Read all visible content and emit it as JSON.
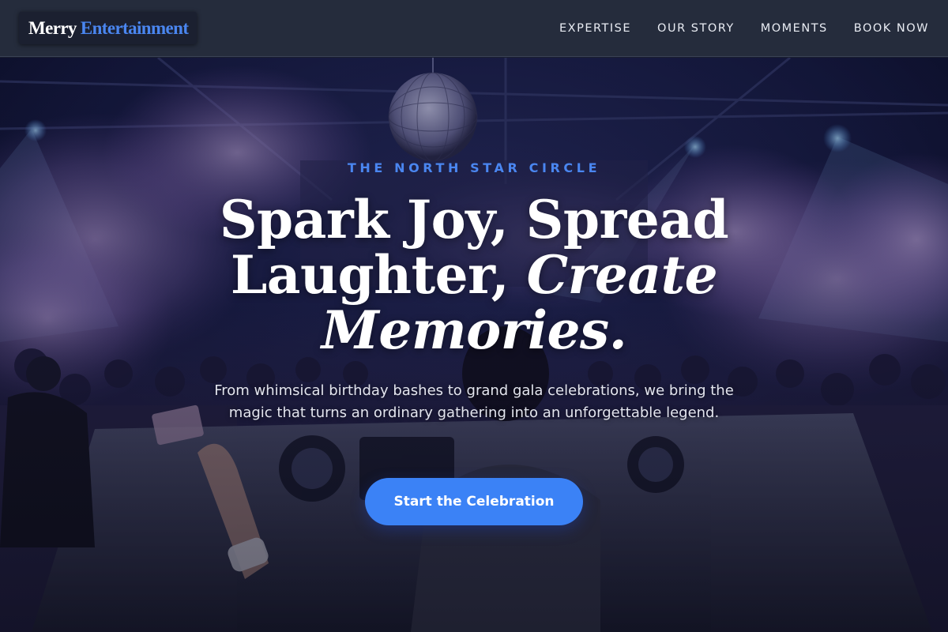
{
  "brand": {
    "word1": "Merry",
    "word2": "Entertainment"
  },
  "nav": [
    {
      "label": "EXPERTISE"
    },
    {
      "label": "OUR STORY"
    },
    {
      "label": "MOMENTS"
    },
    {
      "label": "BOOK NOW"
    }
  ],
  "hero": {
    "image": "concert-crowd-dj-photo",
    "eyebrow": "THE NORTH STAR CIRCLE",
    "headline_line1": "Spark Joy, Spread",
    "headline_line2_plain": "Laughter,",
    "headline_line2_italic": "Create",
    "headline_line3_italic": "Memories.",
    "subtitle": "From whimsical birthday bashes to grand gala celebrations, we bring the magic that turns an ordinary gathering into an unforgettable legend.",
    "cta_label": "Start the Celebration"
  },
  "colors": {
    "header_bg": "#252c3c",
    "accent": "#3b82f6",
    "logo_accent": "#4a86f0",
    "eyebrow": "#4a86f0",
    "text_light": "#ffffff"
  }
}
